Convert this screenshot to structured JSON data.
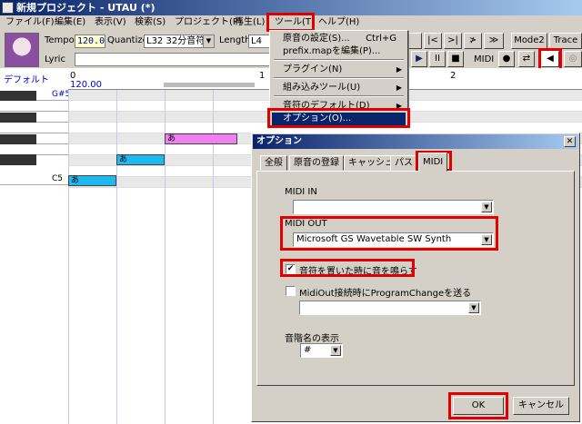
{
  "window": {
    "title": "新規プロジェクト - UTAU (*)"
  },
  "menubar": [
    {
      "label": "ファイル(F)"
    },
    {
      "label": "編集(E)"
    },
    {
      "label": "表示(V)"
    },
    {
      "label": "検索(S)"
    },
    {
      "label": "プロジェクト(P)"
    },
    {
      "label": "再生(L)"
    },
    {
      "label": "ツール(T)"
    },
    {
      "label": "ヘルプ(H)"
    }
  ],
  "toolbar": {
    "tempo_label": "Tempo",
    "tempo_value": "120.0",
    "quantize_label": "Quantize",
    "quantize_value": "L32 32分音符",
    "length_label": "Length",
    "length_value": "L4",
    "lyric_label": "Lyric",
    "mode2": "Mode2",
    "trace": "Trace",
    "midi": "MIDI"
  },
  "tools_menu": [
    {
      "label": "原音の設定(S)...",
      "shortcut": "Ctrl+G"
    },
    {
      "label": "prefix.mapを編集(P)...",
      "shortcut": ""
    },
    {
      "label": "プラグイン(N)",
      "shortcut": "",
      "submenu": true
    },
    {
      "label": "組み込みツール(U)",
      "shortcut": "",
      "submenu": true
    },
    {
      "label": "音符のデフォルト(D)",
      "shortcut": "",
      "submenu": true
    },
    {
      "label": "オプション(O)...",
      "shortcut": ""
    }
  ],
  "piano_roll": {
    "track_label": "デフォルト",
    "ruler": [
      "0",
      "1",
      "2"
    ],
    "tempo_marker": "120.00",
    "key_labels": {
      "gs5": "G#5",
      "c5": "C5"
    },
    "notes": [
      {
        "lyric": "あ"
      },
      {
        "lyric": "あ"
      },
      {
        "lyric": "あ"
      }
    ]
  },
  "options_dialog": {
    "title": "オプション",
    "tabs": [
      "全般",
      "原音の登録",
      "キャッシュ",
      "パス",
      "MIDI"
    ],
    "active_tab": "MIDI",
    "midi_in_label": "MIDI IN",
    "midi_in_value": "",
    "midi_out_label": "MIDI OUT",
    "midi_out_value": "Microsoft GS Wavetable SW Synth",
    "sound_on_place_label": "音符を置いた時に音を鳴らす",
    "sound_on_place_checked": "✔",
    "program_change_label": "MidiOut接続時にProgramChangeを送る",
    "program_change_value": "",
    "note_name_label": "音階名の表示",
    "note_name_value": "#",
    "ok_label": "OK",
    "cancel_label": "キャンセル"
  }
}
